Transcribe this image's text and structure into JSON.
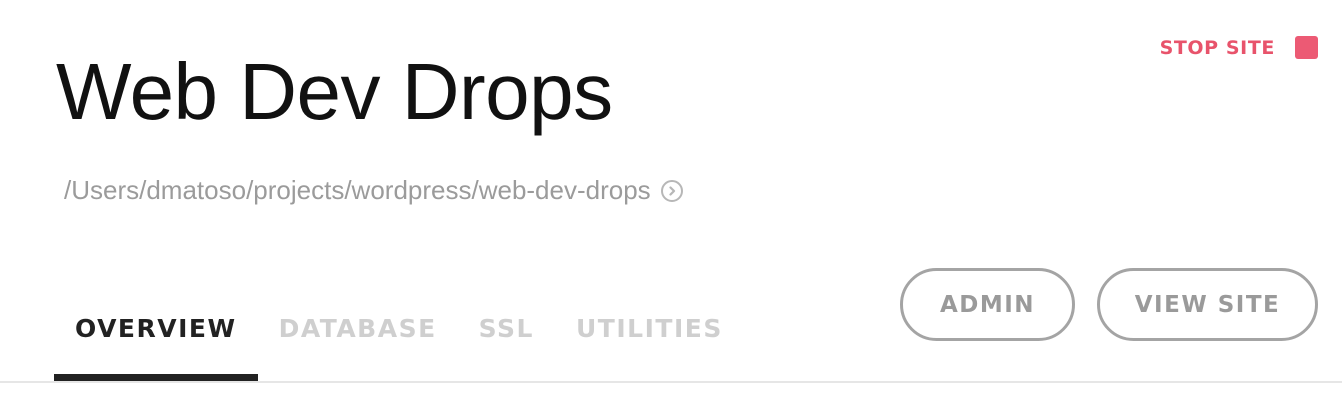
{
  "header": {
    "stop_label": "STOP SITE",
    "stop_color": "#e8536b",
    "title": "Web Dev Drops",
    "path": "/Users/dmatoso/projects/wordpress/web-dev-drops",
    "reveal_icon": "chevron-right-circle-icon"
  },
  "tabs": [
    {
      "label": "OVERVIEW",
      "active": true
    },
    {
      "label": "DATABASE",
      "active": false
    },
    {
      "label": "SSL",
      "active": false
    },
    {
      "label": "UTILITIES",
      "active": false
    }
  ],
  "actions": {
    "admin_label": "ADMIN",
    "view_site_label": "VIEW SITE"
  }
}
